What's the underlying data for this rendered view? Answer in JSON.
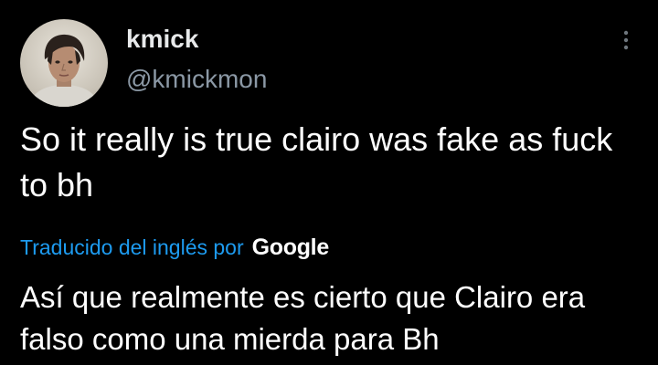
{
  "tweet": {
    "display_name": "kmick",
    "handle": "@kmickmon",
    "text": "So it really is true clairo was fake as fuck to bh",
    "translation_label": "Traducido del inglés por",
    "translation_provider": "Google",
    "translated_text": "Así que realmente es cierto que Clairo era falso como una mierda para Bh"
  },
  "icons": {
    "more": "more-vertical-icon",
    "avatar": "user-avatar"
  },
  "colors": {
    "background": "#000000",
    "primary_text": "#e7e9ea",
    "secondary_text": "#8b98a5",
    "link": "#1d9bf0"
  }
}
